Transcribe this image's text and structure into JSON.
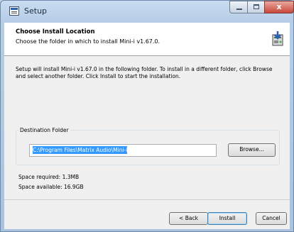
{
  "window": {
    "title": "Setup",
    "close_glyph": "x"
  },
  "header": {
    "title": "Choose Install Location",
    "subtitle": "Choose the folder in which to install Mini-i v1.67.0.",
    "icon": "installer-icon"
  },
  "description": "Setup will install Mini-i v1.67.0 in the following folder. To install in a different folder, click Browse and select another folder. Click Install to start the installation.",
  "destination": {
    "group_label": "Destination Folder",
    "path": "C:\\Program Files\\Matrix Audio\\Mini-i",
    "browse_label": "Browse..."
  },
  "space": {
    "required": "Space required: 1.3MB",
    "available": "Space available: 16.9GB"
  },
  "buttons": {
    "back_label": "< Back",
    "install_label": "Install",
    "cancel_label": "Cancel"
  },
  "colors": {
    "selection": "#3399ff",
    "titlebar": "#b6cde6",
    "close_button": "#c7483a"
  }
}
